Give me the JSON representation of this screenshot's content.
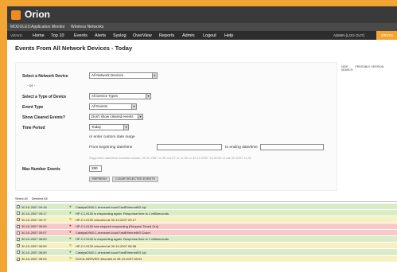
{
  "app": {
    "title": "Orion"
  },
  "modules": {
    "label": "MODULES:",
    "items": [
      "Application Monitor",
      "Wireless Networks"
    ]
  },
  "nav": {
    "views_label": "VIEWS:",
    "items": [
      "Home",
      "Top 10",
      "Events",
      "Alerts",
      "Syslog",
      "OverView",
      "Reports",
      "Admin",
      "Logout",
      "Help"
    ],
    "account": "ADMIN (LOG OUT)",
    "extra": "ORION"
  },
  "page": {
    "title": "Events From All Network Devices - Today",
    "links": [
      "HIDE",
      "PRINTABLE VERSION",
      "SEARCH"
    ]
  },
  "form": {
    "network_device": {
      "label": "Select a Network Device",
      "value": "All Network Devices"
    },
    "or": "- or -",
    "device_type": {
      "label": "Select a Type of Device",
      "value": "All Device Types"
    },
    "event_type": {
      "label": "Event Type",
      "value": "All Events"
    },
    "cleared": {
      "label": "Show Cleared Events?",
      "value": "Don't show cleared events"
    },
    "time_period": {
      "label": "Time Period",
      "value": "Today"
    },
    "custom_range": "or enter custom date range",
    "from_label": "From beginning date/time",
    "to_label": "to ending date/time",
    "format_hint": "Supported date/time formats include: 30.10.2007 or 30.oct.07 or 11:30 or 30.10.2007 11:30:00 or sat 30.2007 11:31",
    "max_events": {
      "label": "Max Number Events",
      "value": "250"
    },
    "refresh_button": "REFRESH",
    "clear_button": "CLEAR SELECTED EVENTS"
  },
  "selection": {
    "select_all": "Select All",
    "deselect_all": "Deselect All"
  },
  "events": [
    {
      "time": "30-10-2007 09:18",
      "message": "Catalyst2940-1.drevsnet.local-FastEthernet0/5 Up",
      "status": "up"
    },
    {
      "time": "30-10-2007 09:17",
      "message": "HP-CJ-9130 is responding again. Response time is 1 milliseconds",
      "status": "up"
    },
    {
      "time": "30-10-2007 09:17",
      "message": "HP-CJ-9130 rebooted at 30-10-2007 09:17",
      "status": "reboot"
    },
    {
      "time": "30-10-2007 09:09",
      "message": "HP-CJ-9130 has stopped responding (Request Timed Out)",
      "status": "down"
    },
    {
      "time": "30-10-2007 09:07",
      "message": "Catalyst2940-1.drevsnet.local-FastEthernet0/5 Down",
      "status": "down"
    },
    {
      "time": "30-10-2007 08:59",
      "message": "HP-CJ-9130 is responding again. Response time is 1 milliseconds",
      "status": "up"
    },
    {
      "time": "30-10-2007 08:59",
      "message": "HP-CJ-9130 rebooted at 30-10-2007 08:58",
      "status": "reboot"
    },
    {
      "time": "30-10-2007 08:59",
      "message": "Catalyst2940-1.drevsnet.local-FastEthernet0/5 Up",
      "status": "up"
    },
    {
      "time": "30-10-2007 08:05",
      "message": "DOCA-SERVER rebooted at 30-10-2007 08:04",
      "status": "reboot"
    }
  ],
  "colors": {
    "up": "#d9ecc7",
    "down": "#f7c9c9",
    "reboot": "#f6f1c3",
    "up_icon": "#2e9a2e",
    "down_icon": "#cc2222",
    "reboot_icon": "#b08800",
    "frame": "#f3a533",
    "header": "#3a3a3a"
  },
  "icons": {
    "up": "green-circle-icon",
    "down": "red-circle-icon",
    "reboot": "reboot-arrow-icon"
  }
}
